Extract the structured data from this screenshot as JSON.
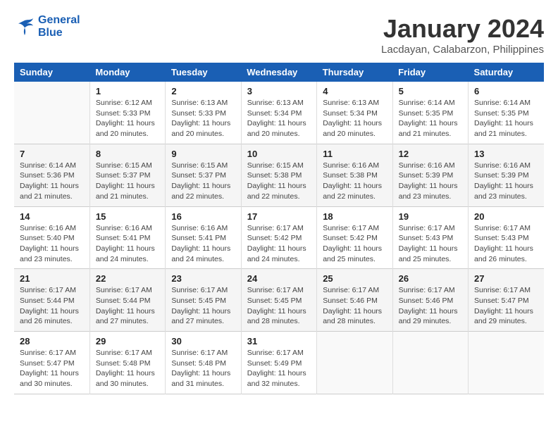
{
  "logo": {
    "line1": "General",
    "line2": "Blue"
  },
  "title": "January 2024",
  "subtitle": "Lacdayan, Calabarzon, Philippines",
  "days_header": [
    "Sunday",
    "Monday",
    "Tuesday",
    "Wednesday",
    "Thursday",
    "Friday",
    "Saturday"
  ],
  "weeks": [
    [
      {
        "num": "",
        "info": ""
      },
      {
        "num": "1",
        "info": "Sunrise: 6:12 AM\nSunset: 5:33 PM\nDaylight: 11 hours and 20 minutes."
      },
      {
        "num": "2",
        "info": "Sunrise: 6:13 AM\nSunset: 5:33 PM\nDaylight: 11 hours and 20 minutes."
      },
      {
        "num": "3",
        "info": "Sunrise: 6:13 AM\nSunset: 5:34 PM\nDaylight: 11 hours and 20 minutes."
      },
      {
        "num": "4",
        "info": "Sunrise: 6:13 AM\nSunset: 5:34 PM\nDaylight: 11 hours and 20 minutes."
      },
      {
        "num": "5",
        "info": "Sunrise: 6:14 AM\nSunset: 5:35 PM\nDaylight: 11 hours and 21 minutes."
      },
      {
        "num": "6",
        "info": "Sunrise: 6:14 AM\nSunset: 5:35 PM\nDaylight: 11 hours and 21 minutes."
      }
    ],
    [
      {
        "num": "7",
        "info": "Sunrise: 6:14 AM\nSunset: 5:36 PM\nDaylight: 11 hours and 21 minutes."
      },
      {
        "num": "8",
        "info": "Sunrise: 6:15 AM\nSunset: 5:37 PM\nDaylight: 11 hours and 21 minutes."
      },
      {
        "num": "9",
        "info": "Sunrise: 6:15 AM\nSunset: 5:37 PM\nDaylight: 11 hours and 22 minutes."
      },
      {
        "num": "10",
        "info": "Sunrise: 6:15 AM\nSunset: 5:38 PM\nDaylight: 11 hours and 22 minutes."
      },
      {
        "num": "11",
        "info": "Sunrise: 6:16 AM\nSunset: 5:38 PM\nDaylight: 11 hours and 22 minutes."
      },
      {
        "num": "12",
        "info": "Sunrise: 6:16 AM\nSunset: 5:39 PM\nDaylight: 11 hours and 23 minutes."
      },
      {
        "num": "13",
        "info": "Sunrise: 6:16 AM\nSunset: 5:39 PM\nDaylight: 11 hours and 23 minutes."
      }
    ],
    [
      {
        "num": "14",
        "info": "Sunrise: 6:16 AM\nSunset: 5:40 PM\nDaylight: 11 hours and 23 minutes."
      },
      {
        "num": "15",
        "info": "Sunrise: 6:16 AM\nSunset: 5:41 PM\nDaylight: 11 hours and 24 minutes."
      },
      {
        "num": "16",
        "info": "Sunrise: 6:16 AM\nSunset: 5:41 PM\nDaylight: 11 hours and 24 minutes."
      },
      {
        "num": "17",
        "info": "Sunrise: 6:17 AM\nSunset: 5:42 PM\nDaylight: 11 hours and 24 minutes."
      },
      {
        "num": "18",
        "info": "Sunrise: 6:17 AM\nSunset: 5:42 PM\nDaylight: 11 hours and 25 minutes."
      },
      {
        "num": "19",
        "info": "Sunrise: 6:17 AM\nSunset: 5:43 PM\nDaylight: 11 hours and 25 minutes."
      },
      {
        "num": "20",
        "info": "Sunrise: 6:17 AM\nSunset: 5:43 PM\nDaylight: 11 hours and 26 minutes."
      }
    ],
    [
      {
        "num": "21",
        "info": "Sunrise: 6:17 AM\nSunset: 5:44 PM\nDaylight: 11 hours and 26 minutes."
      },
      {
        "num": "22",
        "info": "Sunrise: 6:17 AM\nSunset: 5:44 PM\nDaylight: 11 hours and 27 minutes."
      },
      {
        "num": "23",
        "info": "Sunrise: 6:17 AM\nSunset: 5:45 PM\nDaylight: 11 hours and 27 minutes."
      },
      {
        "num": "24",
        "info": "Sunrise: 6:17 AM\nSunset: 5:45 PM\nDaylight: 11 hours and 28 minutes."
      },
      {
        "num": "25",
        "info": "Sunrise: 6:17 AM\nSunset: 5:46 PM\nDaylight: 11 hours and 28 minutes."
      },
      {
        "num": "26",
        "info": "Sunrise: 6:17 AM\nSunset: 5:46 PM\nDaylight: 11 hours and 29 minutes."
      },
      {
        "num": "27",
        "info": "Sunrise: 6:17 AM\nSunset: 5:47 PM\nDaylight: 11 hours and 29 minutes."
      }
    ],
    [
      {
        "num": "28",
        "info": "Sunrise: 6:17 AM\nSunset: 5:47 PM\nDaylight: 11 hours and 30 minutes."
      },
      {
        "num": "29",
        "info": "Sunrise: 6:17 AM\nSunset: 5:48 PM\nDaylight: 11 hours and 30 minutes."
      },
      {
        "num": "30",
        "info": "Sunrise: 6:17 AM\nSunset: 5:48 PM\nDaylight: 11 hours and 31 minutes."
      },
      {
        "num": "31",
        "info": "Sunrise: 6:17 AM\nSunset: 5:49 PM\nDaylight: 11 hours and 32 minutes."
      },
      {
        "num": "",
        "info": ""
      },
      {
        "num": "",
        "info": ""
      },
      {
        "num": "",
        "info": ""
      }
    ]
  ]
}
